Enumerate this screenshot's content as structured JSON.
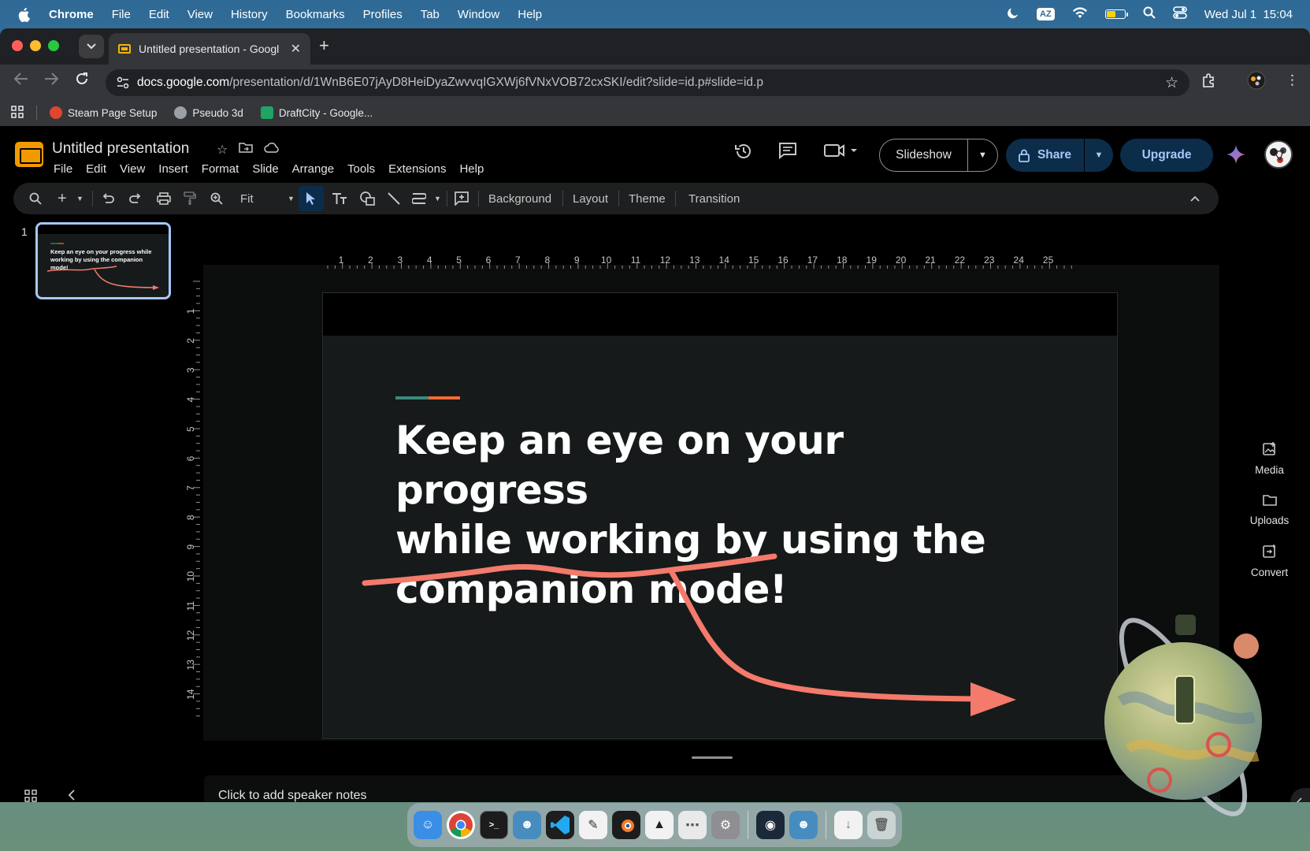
{
  "menubar": {
    "app": "Chrome",
    "items": [
      "File",
      "Edit",
      "View",
      "History",
      "Bookmarks",
      "Profiles",
      "Tab",
      "Window",
      "Help"
    ],
    "input_source": "AZ",
    "datetime": "Wed Jul 1  15:04"
  },
  "browser": {
    "tab_title": "Untitled presentation - Googl",
    "url_host": "docs.google.com",
    "url_path": "/presentation/d/1WnB6E07jAyD8HeiDyaZwvvqIGXWj6fVNxVOB72cxSKI/edit?slide=id.p#slide=id.p",
    "bookmarks": [
      {
        "label": "Steam Page Setup",
        "color": "#e2452f"
      },
      {
        "label": "Pseudo 3d",
        "color": "#9aa0a6"
      },
      {
        "label": "DraftCity - Google...",
        "color": "#1fa463"
      }
    ]
  },
  "slides_app": {
    "title": "Untitled presentation",
    "menu": [
      "File",
      "Edit",
      "View",
      "Insert",
      "Format",
      "Slide",
      "Arrange",
      "Tools",
      "Extensions",
      "Help"
    ],
    "slideshow_label": "Slideshow",
    "share_label": "Share",
    "upgrade_label": "Upgrade",
    "toolbar": {
      "zoom": "Fit",
      "background": "Background",
      "layout": "Layout",
      "theme": "Theme",
      "transition": "Transition"
    },
    "ruler_h": [
      "1",
      "2",
      "3",
      "4",
      "5",
      "6",
      "7",
      "8",
      "9",
      "10",
      "11",
      "12",
      "13",
      "14",
      "15",
      "16",
      "17",
      "18",
      "19",
      "20",
      "21",
      "22",
      "23",
      "24",
      "25"
    ],
    "ruler_v": [
      "1",
      "2",
      "3",
      "4",
      "5",
      "6",
      "7",
      "8",
      "9",
      "10",
      "11",
      "12",
      "13",
      "14"
    ],
    "slide_number": "1",
    "slide": {
      "headline_1": "Keep an eye on your progress",
      "headline_2": "while working by using the",
      "headline_3": "companion mode!",
      "accent_colors": [
        "#3a8a7b",
        "#f26b3a"
      ],
      "annotation_color": "#f47a6b"
    },
    "thumb_text": "Keep an eye on your progress while working by using the companion mode!",
    "side_panel": [
      {
        "label": "Media",
        "icon": "media-icon"
      },
      {
        "label": "Uploads",
        "icon": "folder-icon"
      },
      {
        "label": "Convert",
        "icon": "convert-icon"
      }
    ],
    "notes_placeholder": "Click to add speaker notes"
  }
}
